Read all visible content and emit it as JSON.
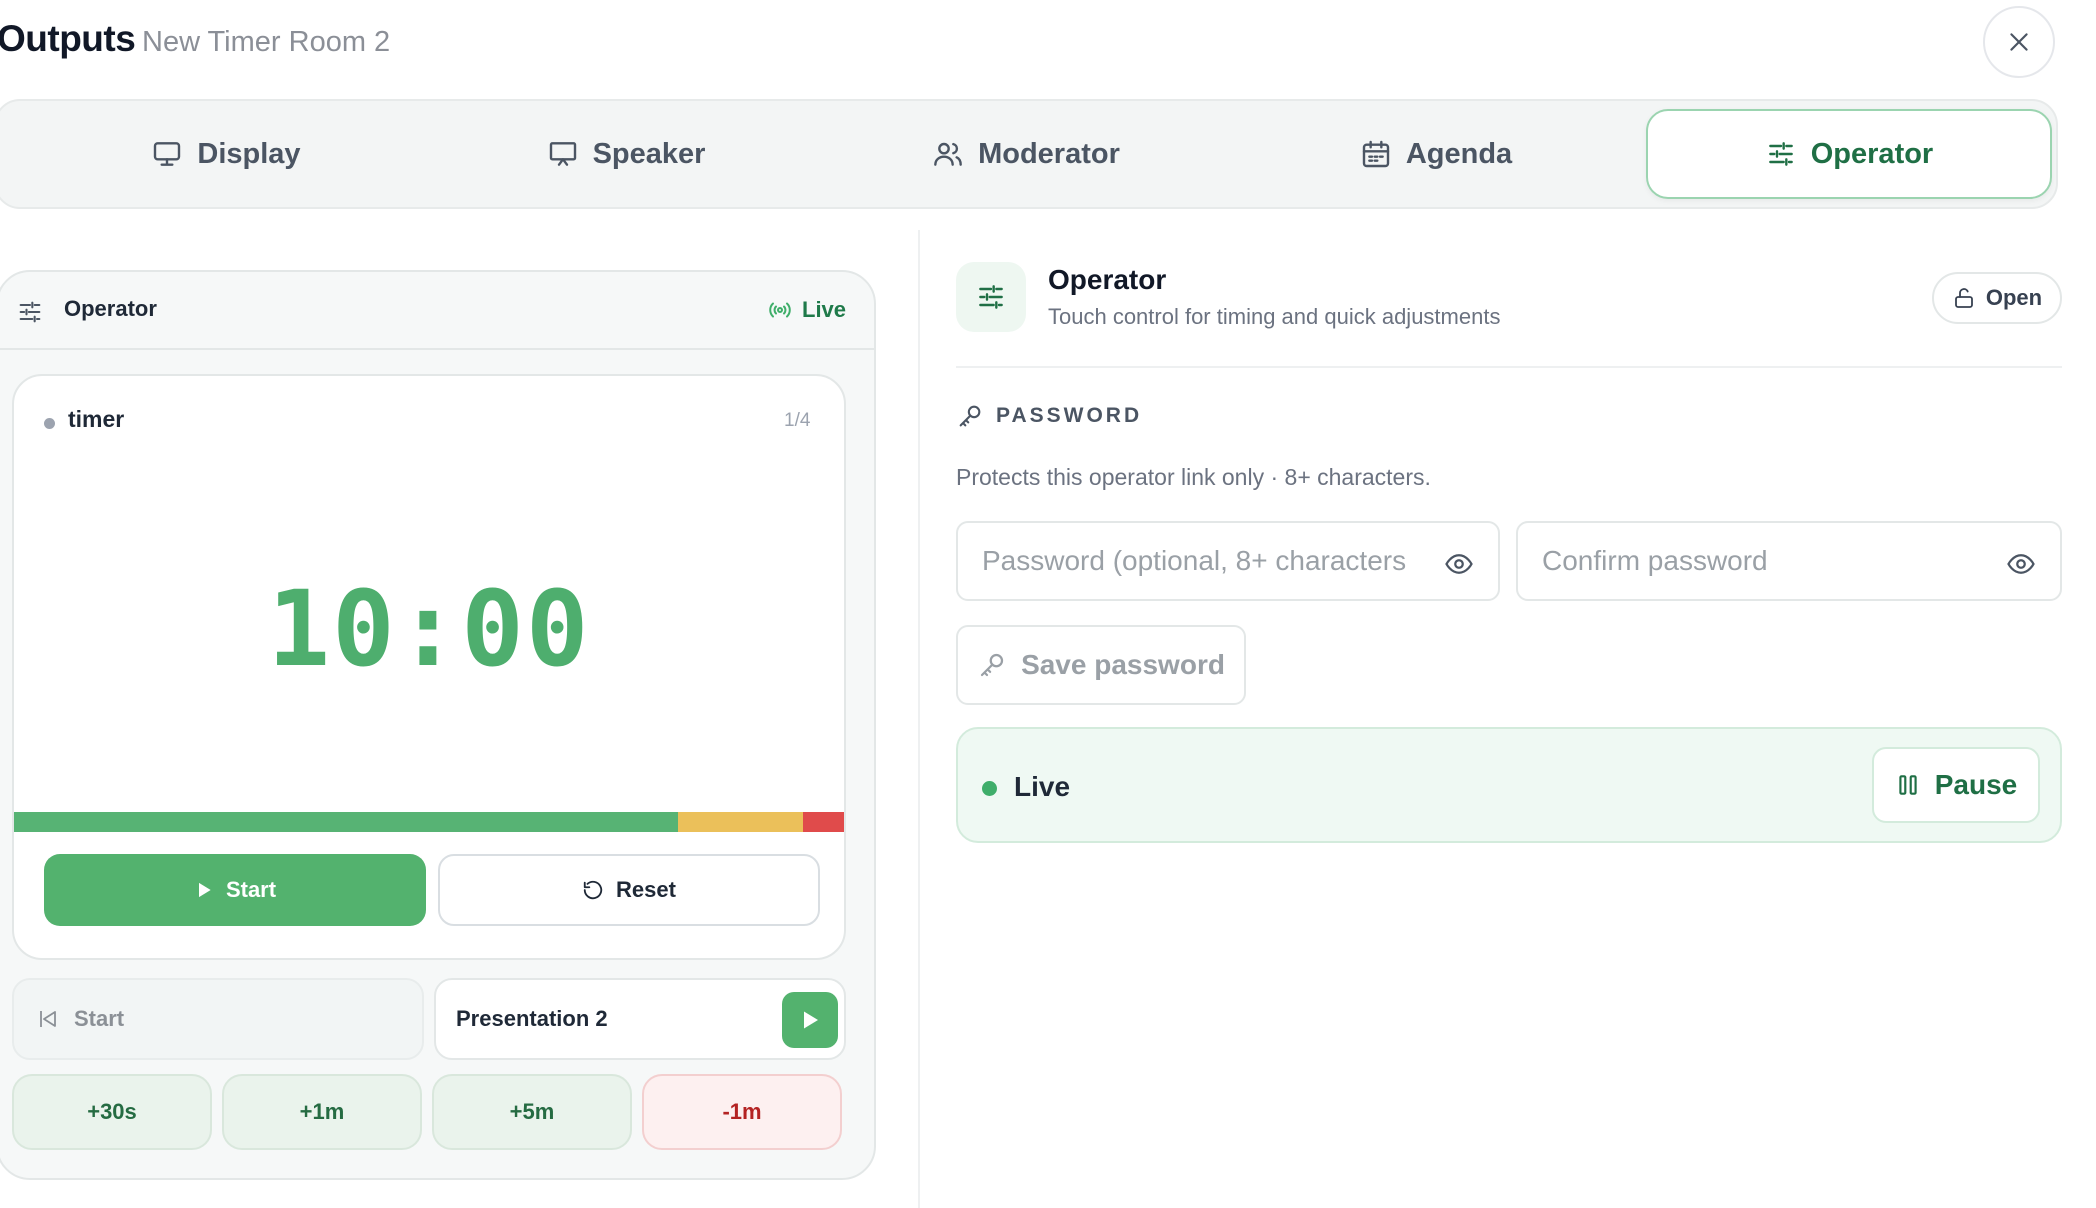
{
  "header": {
    "title": "Outputs",
    "subtitle": "New Timer Room 2",
    "close_icon": "close-icon"
  },
  "tabs": [
    {
      "label": "Display",
      "icon": "monitor-icon"
    },
    {
      "label": "Speaker",
      "icon": "presentation-icon"
    },
    {
      "label": "Moderator",
      "icon": "users-icon"
    },
    {
      "label": "Agenda",
      "icon": "calendar-icon"
    },
    {
      "label": "Operator",
      "icon": "sliders-icon",
      "active": true
    }
  ],
  "preview": {
    "header_label": "Operator",
    "status_label": "Live",
    "timer": {
      "name": "timer",
      "counter": "1/4",
      "time": "10:00",
      "progress_segments": [
        {
          "color": "#57b374",
          "fraction": 0.8
        },
        {
          "color": "#ebc05a",
          "fraction": 0.15
        },
        {
          "color": "#e04b4b",
          "fraction": 0.05
        }
      ]
    },
    "start_label": "Start",
    "reset_label": "Reset",
    "previous_label": "Start",
    "next_label": "Presentation 2",
    "adjustments": [
      {
        "label": "+30s",
        "kind": "plus"
      },
      {
        "label": "+1m",
        "kind": "plus"
      },
      {
        "label": "+5m",
        "kind": "plus"
      },
      {
        "label": "-1m",
        "kind": "minus"
      }
    ]
  },
  "operator": {
    "title": "Operator",
    "description": "Touch control for timing and quick adjustments",
    "open_label": "Open"
  },
  "password": {
    "heading": "PASSWORD",
    "help": "Protects this operator link only · 8+ characters.",
    "password_placeholder": "Password (optional, 8+ characters",
    "password_value": "",
    "confirm_placeholder": "Confirm password",
    "confirm_value": "",
    "save_label": "Save password"
  },
  "live": {
    "status": "Live",
    "pause_label": "Pause"
  },
  "colors": {
    "accent": "#53b26e",
    "accent_dark": "#1f6f45",
    "danger": "#b42323"
  }
}
